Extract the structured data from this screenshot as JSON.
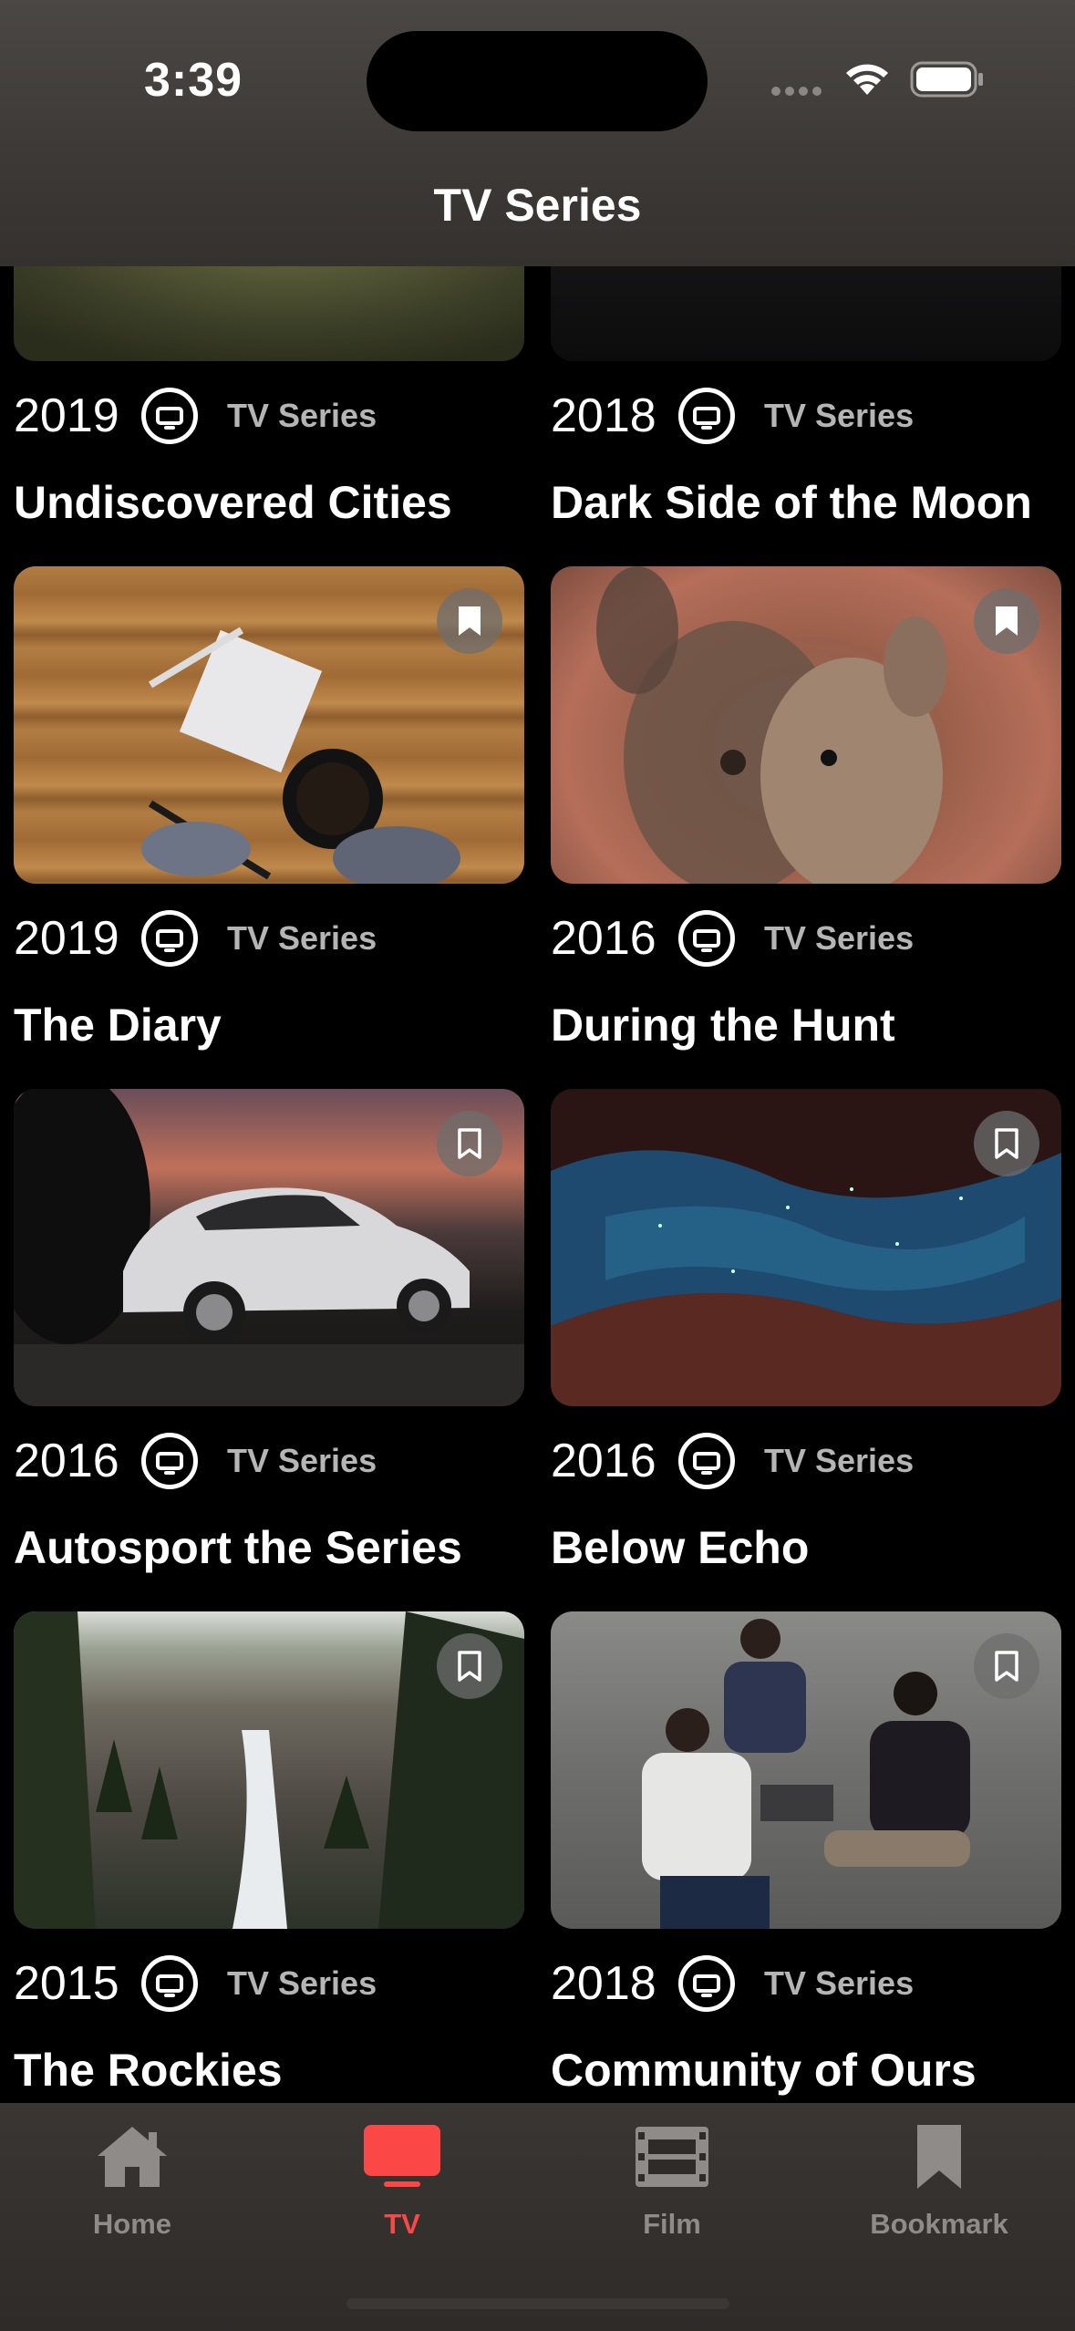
{
  "status_bar": {
    "time": "3:39"
  },
  "header": {
    "title": "TV Series"
  },
  "cards": [
    {
      "year": "2019",
      "category": "TV Series",
      "title": "Undiscovered Cities"
    },
    {
      "year": "2018",
      "category": "TV Series",
      "title": "Dark Side of the Moon"
    },
    {
      "year": "2019",
      "category": "TV Series",
      "title": "The Diary"
    },
    {
      "year": "2016",
      "category": "TV Series",
      "title": "During the Hunt"
    },
    {
      "year": "2016",
      "category": "TV Series",
      "title": "Autosport the Series"
    },
    {
      "year": "2016",
      "category": "TV Series",
      "title": "Below Echo"
    },
    {
      "year": "2015",
      "category": "TV Series",
      "title": "The Rockies"
    },
    {
      "year": "2018",
      "category": "TV Series",
      "title": "Community of Ours"
    }
  ],
  "bookmarks": [
    {
      "state": "filled"
    },
    {
      "state": "filled"
    },
    {
      "state": "outline"
    },
    {
      "state": "outline"
    },
    {
      "state": "outline"
    },
    {
      "state": "outline"
    }
  ],
  "tabs": [
    {
      "label": "Home",
      "icon": "house-icon",
      "active": false
    },
    {
      "label": "TV",
      "icon": "tv-icon",
      "active": true
    },
    {
      "label": "Film",
      "icon": "film-icon",
      "active": false
    },
    {
      "label": "Bookmark",
      "icon": "bookmark-icon",
      "active": false
    }
  ],
  "colors": {
    "accent": "#fc4747",
    "inactive_tab": "#8e8b88",
    "background": "#000000"
  }
}
